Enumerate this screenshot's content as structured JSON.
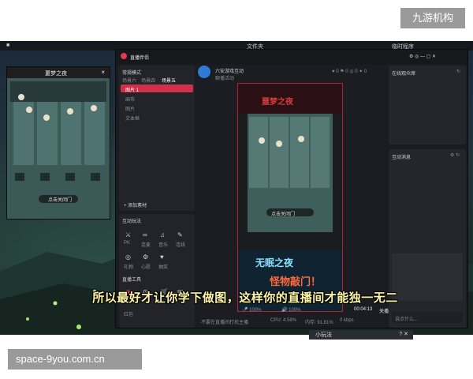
{
  "watermark": {
    "brand": "九游机构",
    "url": "space-9you.com.cn"
  },
  "subtitle": "所以最好才让你学下做图，这样你的直播间才能独一无二",
  "desktop": {
    "topbar_left": "文件夹",
    "topbar_right": "临时程序"
  },
  "game_window": {
    "title": "噩梦之夜",
    "close": "×",
    "button_label": "点击关闭门"
  },
  "app": {
    "title": "直播伴侣",
    "left_tabs": [
      "常规模式",
      "场景六",
      "场景四",
      "场景五"
    ],
    "add_label": "+ 添加素材",
    "sources": [
      "图片 1",
      "画布",
      "图片",
      "文本框"
    ],
    "interact_title": "互动玩法",
    "tools": [
      "PK",
      "连麦",
      "音乐",
      "连线",
      "礼物",
      "心愿",
      "抽奖",
      "红包"
    ],
    "more_tools_title": "直播工具",
    "channel_name": "六安游戏互动",
    "channel_sub": "聊播活动",
    "stats": [
      "0",
      "0",
      "0",
      "0"
    ],
    "right_top_title": "在线观众席",
    "right_bot_title": "互动消息",
    "chat_placeholder": "说点什么...",
    "footer_left": "不要在直播间打扰主播",
    "cpu": "CPU: 4.58%",
    "mem": "内存: 91.81%",
    "dropped": "丢帧: 0%",
    "bitrate": "0 kbps",
    "time": "00:04:13",
    "end_label": "关播",
    "volume1": "100%",
    "volume2": "100%"
  },
  "preview": {
    "game_title": "噩梦之夜",
    "banner1": "无眠之夜",
    "banner2": "怪物敲门！",
    "door_btn": "点击关闭门"
  },
  "bottom_strip": {
    "label": "小玩法"
  },
  "colors": {
    "accent_red": "#d0304a",
    "subtitle_yellow": "#fff6a8",
    "badge_gray": "#9a9a9a"
  }
}
